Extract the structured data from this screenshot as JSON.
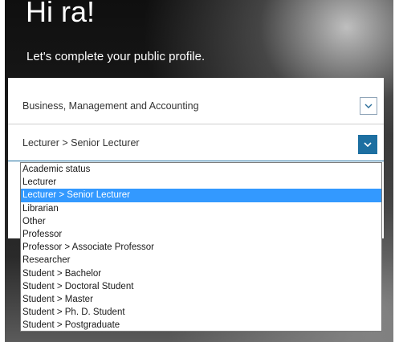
{
  "header": {
    "greeting": "Hi ra!",
    "subtitle": "Let's complete your public profile."
  },
  "form": {
    "subject_value": "Business, Management and Accounting",
    "position_value": "Lecturer > Senior Lecturer"
  },
  "dropdown": {
    "selected_index": 2,
    "options": [
      "Academic status",
      "Lecturer",
      "Lecturer > Senior Lecturer",
      "Librarian",
      "Other",
      "Professor",
      "Professor > Associate Professor",
      "Researcher",
      "Student > Bachelor",
      "Student > Doctoral Student",
      "Student > Master",
      "Student > Ph. D. Student",
      "Student > Postgraduate"
    ]
  },
  "icons": {
    "subject_toggle": "chevron-down-icon",
    "position_toggle": "chevron-down-icon"
  },
  "colors": {
    "accent": "#1d6fa1",
    "selection": "#3399ff"
  }
}
